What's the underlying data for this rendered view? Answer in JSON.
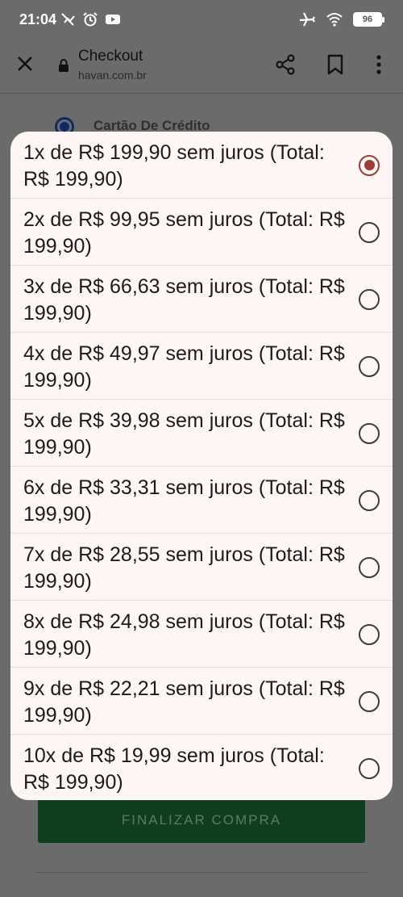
{
  "status_bar": {
    "time": "21:04",
    "battery": "96"
  },
  "browser": {
    "title": "Checkout",
    "url": "havan.com.br"
  },
  "page": {
    "payment_method_label": "Cartão De Crédito",
    "finalize_button": "FINALIZAR COMPRA"
  },
  "installments": {
    "selected_index": 0,
    "options": [
      {
        "label": "1x de R$ 199,90 sem juros (Total: R$ 199,90)"
      },
      {
        "label": "2x de R$ 99,95 sem juros (Total: R$ 199,90)"
      },
      {
        "label": "3x de R$ 66,63 sem juros (Total: R$ 199,90)"
      },
      {
        "label": "4x de R$ 49,97 sem juros (Total: R$ 199,90)"
      },
      {
        "label": "5x de R$ 39,98 sem juros (Total: R$ 199,90)"
      },
      {
        "label": "6x de R$ 33,31 sem juros (Total: R$ 199,90)"
      },
      {
        "label": "7x de R$ 28,55 sem juros (Total: R$ 199,90)"
      },
      {
        "label": "8x de R$ 24,98 sem juros (Total: R$ 199,90)"
      },
      {
        "label": "9x de R$ 22,21 sem juros (Total: R$ 199,90)"
      },
      {
        "label": "10x de R$ 19,99 sem juros (Total: R$ 199,90)"
      }
    ]
  },
  "colors": {
    "dialog_bg": "#fdf6f4",
    "radio_selected": "#9c3d33",
    "finalize_button": "#0f3f1f",
    "scrim": "#6b6b6b"
  }
}
